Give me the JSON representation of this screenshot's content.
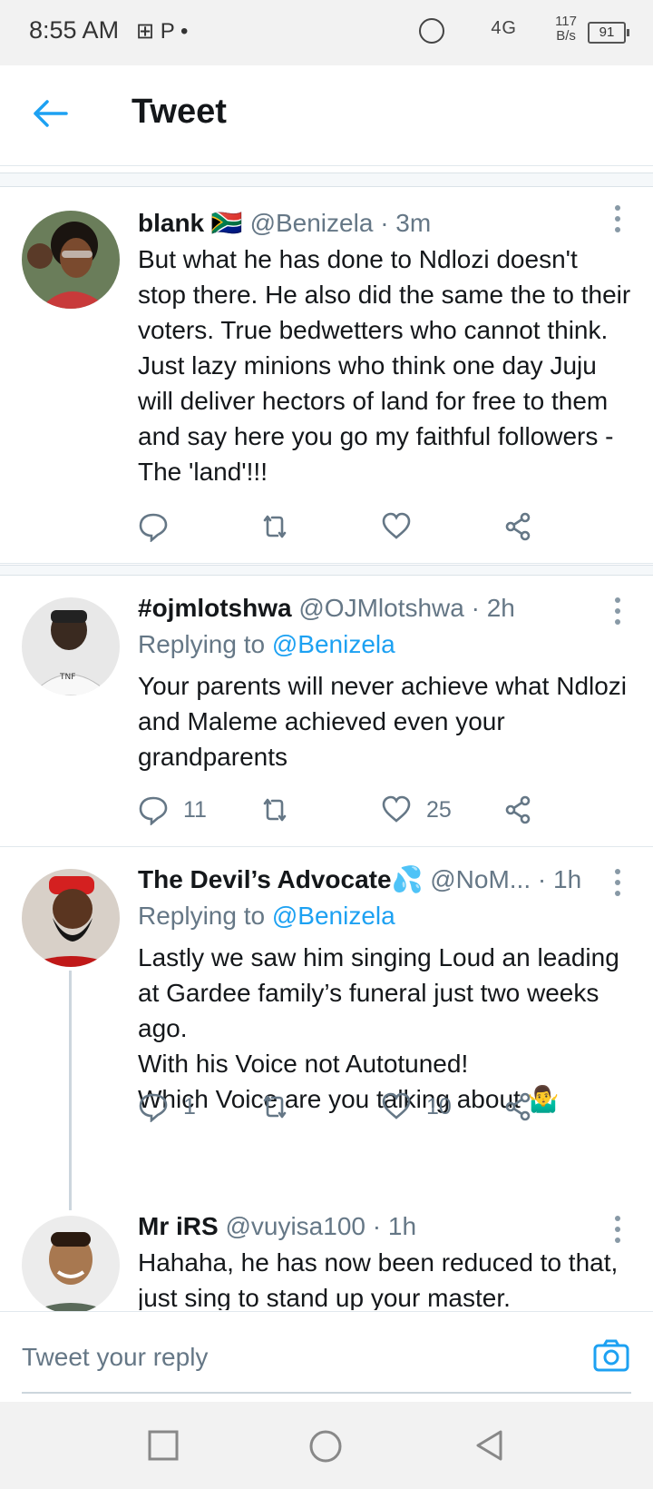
{
  "status_bar": {
    "time": "8:55 AM",
    "left_icons": "⊞ P •",
    "network": "4G",
    "speed_value": "117",
    "speed_unit": "B/s",
    "battery": "91"
  },
  "header": {
    "title": "Tweet"
  },
  "tweets": [
    {
      "name": "blank 🇿🇦",
      "handle": "@Benizela",
      "time": "· 3m",
      "text": "But what he has done to Ndlozi doesn't stop there. He also did the same the to their voters. True bedwetters who cannot think. Just lazy minions who think one day Juju will deliver hectors of land for free to them and say here you go my faithful followers - The 'land'!!!",
      "reply_count": "",
      "like_count": ""
    },
    {
      "name": "#ojmlotshwa",
      "handle": "@OJMlotshwa",
      "time": "· 2h",
      "replying_label": "Replying to",
      "replying_to": "@Benizela",
      "text": "Your parents will never achieve what Ndlozi and Maleme achieved even your grandparents",
      "reply_count": "11",
      "like_count": "25"
    },
    {
      "name": "The Devil’s Advocate💦",
      "handle": "@NoM...",
      "time": "· 1h",
      "replying_label": "Replying to",
      "replying_to": "@Benizela",
      "text_lines": [
        "Lastly we saw him singing Loud an leading at Gardee family’s funeral just two weeks ago.",
        "With his Voice not Autotuned!",
        "Which Voice are you talking about 🤷‍♂️"
      ],
      "reply_count": "1",
      "like_count": "10"
    },
    {
      "name": "Mr iRS",
      "handle": "@vuyisa100",
      "time": "· 1h",
      "text": "Hahaha, he has now been reduced to that, just sing to stand up your master."
    }
  ],
  "reply_bar": {
    "placeholder": "Tweet your reply"
  },
  "colors": {
    "accent": "#1da1f2",
    "muted": "#657786",
    "text": "#14171a"
  }
}
